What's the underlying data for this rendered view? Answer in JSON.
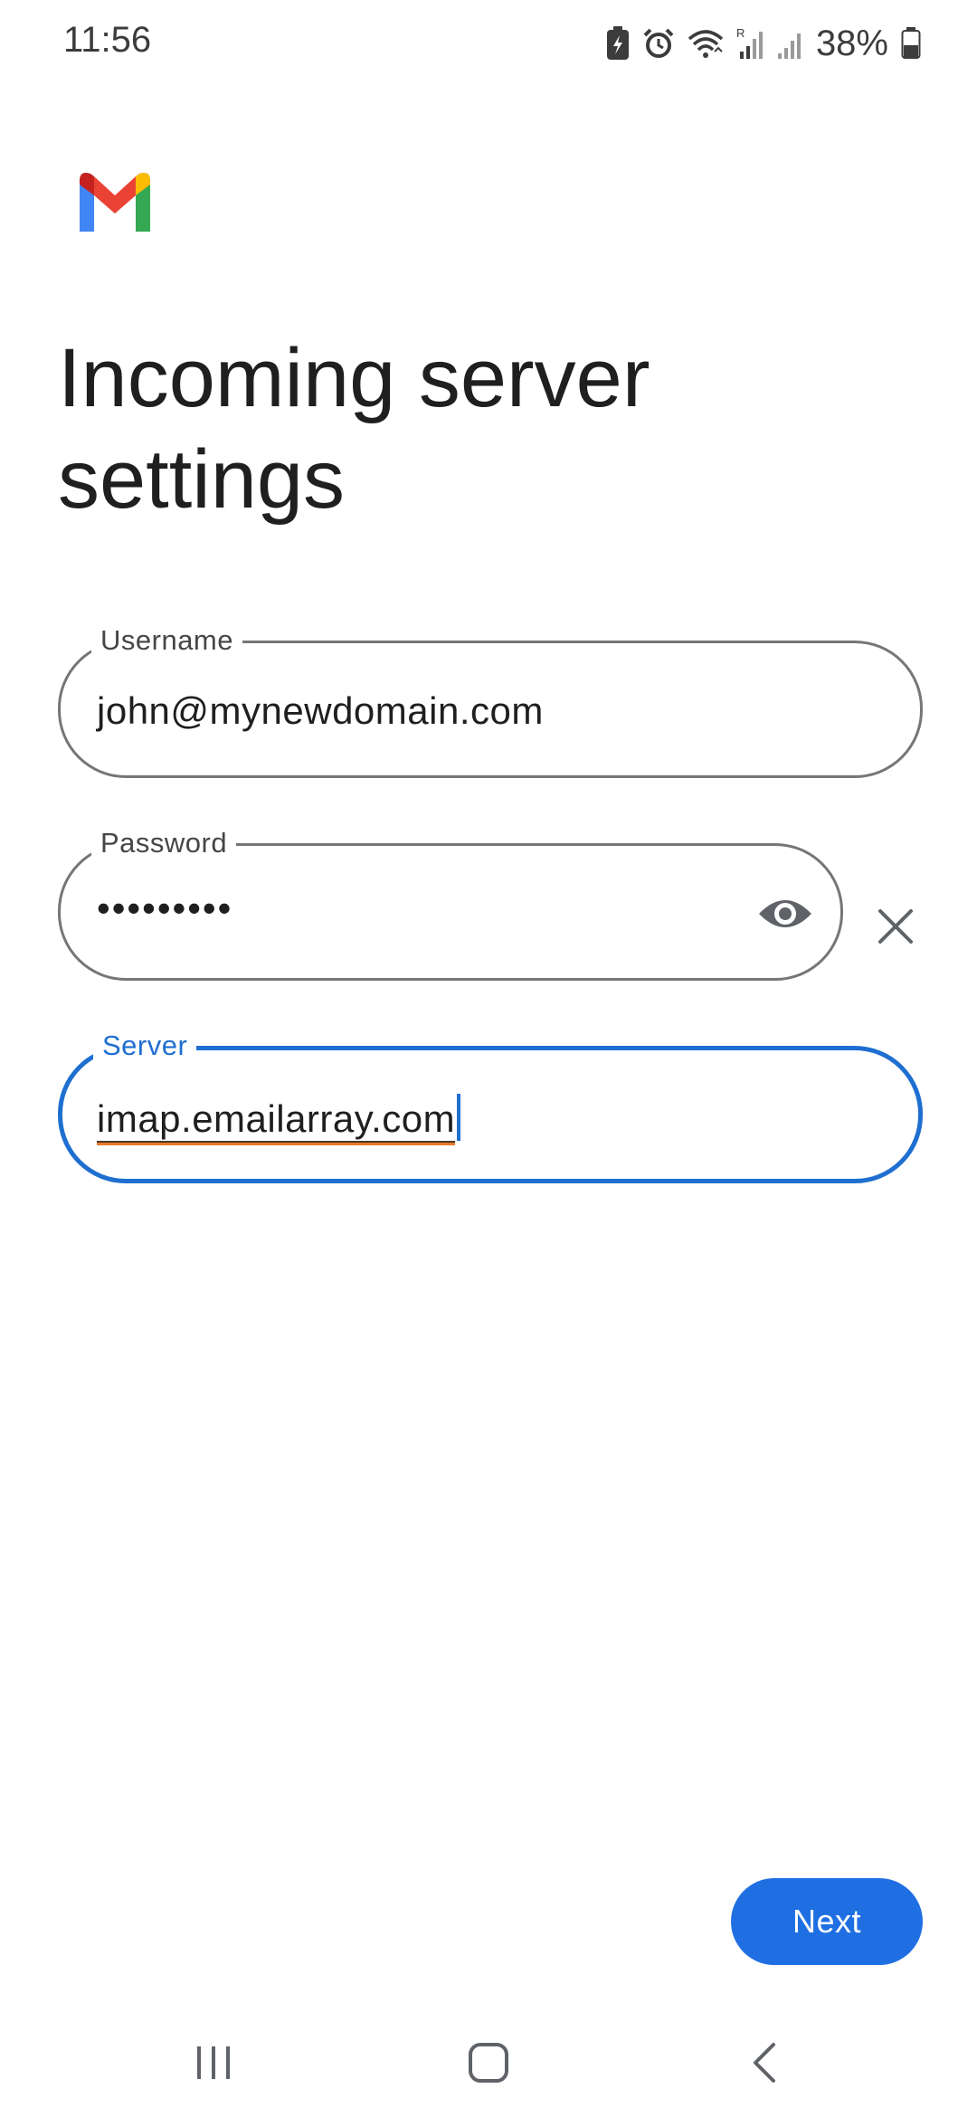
{
  "status_bar": {
    "time": "11:56",
    "battery_percent": "38%",
    "icons": [
      "battery-saver-icon",
      "alarm-icon",
      "wifi-icon",
      "signal-roaming-icon",
      "signal-icon",
      "battery-icon"
    ]
  },
  "header": {
    "logo": "gmail-logo",
    "title": "Incoming server settings"
  },
  "form": {
    "username": {
      "label": "Username",
      "value": "john@mynewdomain.com"
    },
    "password": {
      "label": "Password",
      "masked_value": "•••••••••",
      "toggle_icon": "eye-icon",
      "clear_icon": "close-icon"
    },
    "server": {
      "label": "Server",
      "value": "imap.emailarray.com"
    }
  },
  "actions": {
    "next_label": "Next"
  },
  "nav_bar": {
    "icons": [
      "recents-icon",
      "home-icon",
      "back-icon"
    ]
  },
  "colors": {
    "accent": "#1f6fe3",
    "focus_border": "#1f6fd1",
    "field_border": "#747775",
    "spellcheck_underline": "#e9782a"
  }
}
